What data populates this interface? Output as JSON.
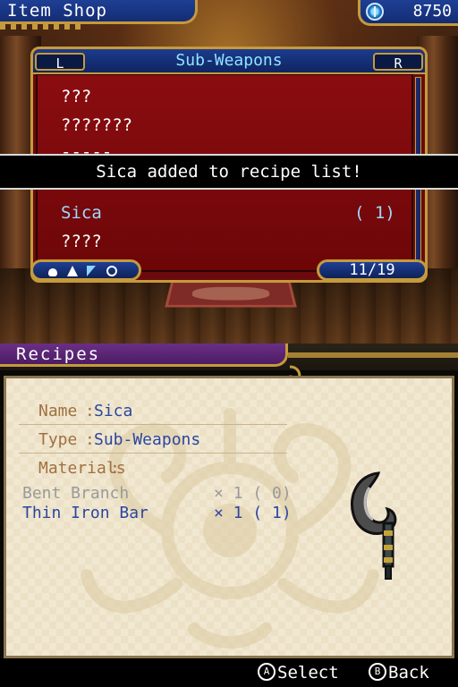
{
  "shop": {
    "title": "Item Shop",
    "gold": "8750"
  },
  "list_panel": {
    "category": "Sub-Weapons",
    "left_button": "L",
    "right_button": "R",
    "items": [
      {
        "name": "???",
        "qty": "",
        "selected": false
      },
      {
        "name": "???????",
        "qty": "",
        "selected": false
      },
      {
        "name": "-----",
        "qty": "",
        "selected": false
      },
      {
        "name": "Sica",
        "qty": "( 1)",
        "selected": true
      },
      {
        "name": "????",
        "qty": "",
        "selected": false
      }
    ],
    "page_count": "11/19",
    "scroll_fraction": 0.55,
    "filter_icons": [
      "pot-icon",
      "flask-icon",
      "cursor-icon",
      "ring-icon"
    ]
  },
  "notice": {
    "text": "Sica added to recipe list!"
  },
  "recipes": {
    "title": "Recipes",
    "name_label": "Name",
    "name_value": "Sica",
    "type_label": "Type",
    "type_value": "Sub-Weapons",
    "materials_label": "Materials",
    "materials": [
      {
        "name": "Bent Branch",
        "qty": "× 1 ( 0)",
        "owned": false
      },
      {
        "name": "Thin Iron Bar",
        "qty": "× 1 ( 1)",
        "owned": true
      }
    ],
    "item_art": "sica-sickle-icon"
  },
  "controls": {
    "select_button": "A",
    "select_label": "Select",
    "back_button": "B",
    "back_label": "Back"
  },
  "colors": {
    "ui_blue": "#1e3f95",
    "gold_trim": "#c59a3c",
    "list_red": "#8a0d10",
    "highlight_cyan": "#8fe3ff",
    "recipe_purple": "#6a2f86",
    "parchment": "#f1e8d2",
    "label_brown": "#a07040",
    "value_blue": "#2b46a0"
  }
}
